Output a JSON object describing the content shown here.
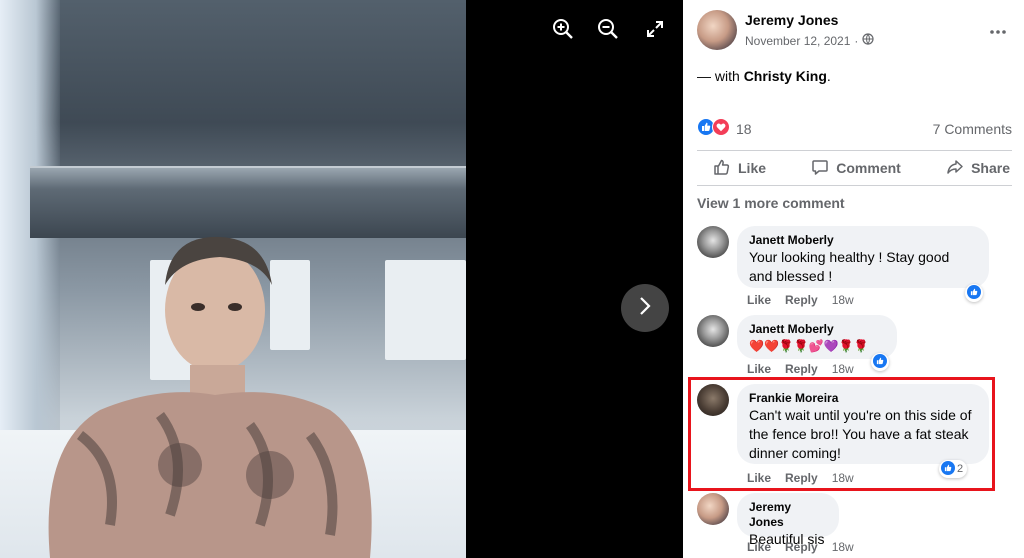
{
  "viewer": {
    "tools": [
      "zoom-in-icon",
      "zoom-out-icon",
      "fullscreen-icon"
    ],
    "next_icon": "chevron-right-icon"
  },
  "post": {
    "author": "Jeremy Jones",
    "date": "November 12, 2021",
    "with_prefix": "— with ",
    "with_name": "Christy King",
    "with_suffix": ".",
    "reaction_count": "18",
    "comments_count": "7 Comments",
    "actions": {
      "like": "Like",
      "comment": "Comment",
      "share": "Share"
    },
    "view_more": "View 1 more comment"
  },
  "comments": [
    {
      "name": "Janett Moberly",
      "text_lines": [
        "Your looking healthy ! Stay good",
        "and blessed !"
      ],
      "like": "Like",
      "reply": "Reply",
      "time": "18w",
      "reaction_count": ""
    },
    {
      "name": "Janett Moberly",
      "text": "❤️❤️🌹🌹💕💜🌹🌹",
      "like": "Like",
      "reply": "Reply",
      "time": "18w",
      "reaction_count": ""
    },
    {
      "name": "Frankie Moreira",
      "text_lines": [
        "Can't wait until you're on this side of",
        "the fence bro!! You have a fat steak",
        "dinner coming!"
      ],
      "like": "Like",
      "reply": "Reply",
      "time": "18w",
      "reaction_count": "2"
    },
    {
      "name": "Jeremy Jones",
      "text": "Beautiful sis",
      "like": "Like",
      "reply": "Reply",
      "time": "18w"
    }
  ],
  "colors": {
    "highlight": "#e8141c",
    "like_blue": "#1877f2",
    "love_red": "#f33e58",
    "muted": "#65676b"
  }
}
